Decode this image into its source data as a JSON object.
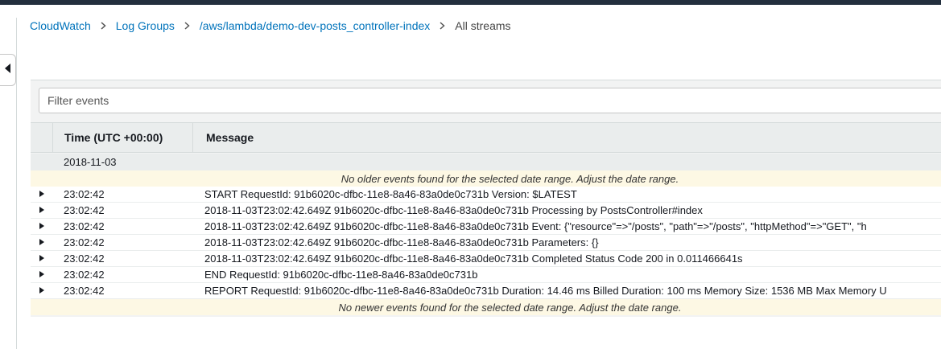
{
  "breadcrumb": {
    "items": [
      {
        "label": "CloudWatch"
      },
      {
        "label": "Log Groups"
      },
      {
        "label": "/aws/lambda/demo-dev-posts_controller-index"
      }
    ],
    "current": "All streams"
  },
  "filter": {
    "placeholder": "Filter events",
    "value": ""
  },
  "table": {
    "columns": {
      "time": "Time (UTC +00:00)",
      "message": "Message"
    },
    "date": "2018-11-03",
    "notice_older": "No older events found for the selected date range. Adjust the date range.",
    "notice_newer": "No newer events found for the selected date range. Adjust the date range.",
    "events": [
      {
        "time": "23:02:42",
        "message": "START RequestId: 91b6020c-dfbc-11e8-8a46-83a0de0c731b Version: $LATEST"
      },
      {
        "time": "23:02:42",
        "message": "2018-11-03T23:02:42.649Z 91b6020c-dfbc-11e8-8a46-83a0de0c731b Processing by PostsController#index"
      },
      {
        "time": "23:02:42",
        "message": "2018-11-03T23:02:42.649Z 91b6020c-dfbc-11e8-8a46-83a0de0c731b Event: {\"resource\"=>\"/posts\", \"path\"=>\"/posts\", \"httpMethod\"=>\"GET\", \"h"
      },
      {
        "time": "23:02:42",
        "message": "2018-11-03T23:02:42.649Z 91b6020c-dfbc-11e8-8a46-83a0de0c731b Parameters: {}"
      },
      {
        "time": "23:02:42",
        "message": "2018-11-03T23:02:42.649Z 91b6020c-dfbc-11e8-8a46-83a0de0c731b Completed Status Code 200 in 0.011466641s"
      },
      {
        "time": "23:02:42",
        "message": "END RequestId: 91b6020c-dfbc-11e8-8a46-83a0de0c731b"
      },
      {
        "time": "23:02:42",
        "message": "REPORT RequestId: 91b6020c-dfbc-11e8-8a46-83a0de0c731b Duration: 14.46 ms Billed Duration: 100 ms Memory Size: 1536 MB Max Memory U"
      }
    ]
  },
  "colors": {
    "link": "#0073bb",
    "topbar": "#232f3e",
    "notice_bg": "#fdf8e4"
  },
  "icons": {
    "collapse": "caret-left-icon",
    "separator": "chevron-right-icon",
    "expand": "caret-right-icon"
  }
}
